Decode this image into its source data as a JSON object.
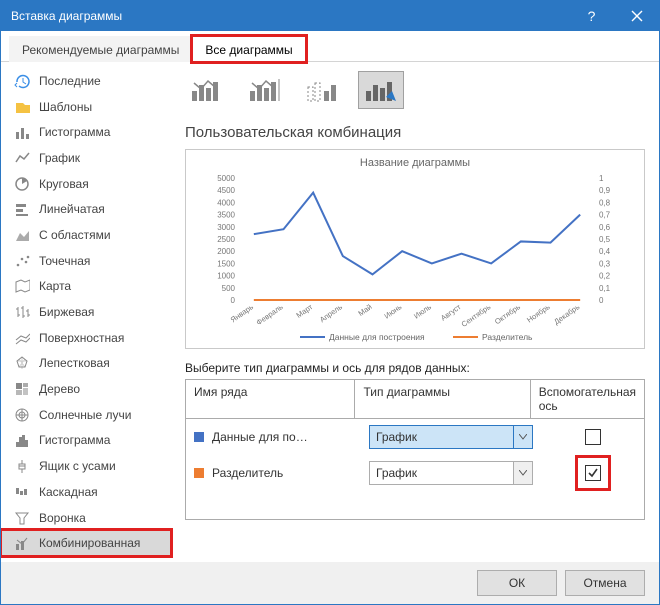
{
  "window": {
    "title": "Вставка диаграммы"
  },
  "tabs": {
    "recommended": "Рекомендуемые диаграммы",
    "all": "Все диаграммы",
    "active": "all"
  },
  "sidebar": {
    "items": [
      {
        "label": "Последние",
        "icon": "recent"
      },
      {
        "label": "Шаблоны",
        "icon": "templates"
      },
      {
        "label": "Гистограмма",
        "icon": "bar"
      },
      {
        "label": "График",
        "icon": "line"
      },
      {
        "label": "Круговая",
        "icon": "pie"
      },
      {
        "label": "Линейчатая",
        "icon": "hbar"
      },
      {
        "label": "С областями",
        "icon": "area"
      },
      {
        "label": "Точечная",
        "icon": "scatter"
      },
      {
        "label": "Карта",
        "icon": "map"
      },
      {
        "label": "Биржевая",
        "icon": "stock"
      },
      {
        "label": "Поверхностная",
        "icon": "surface"
      },
      {
        "label": "Лепестковая",
        "icon": "radar"
      },
      {
        "label": "Дерево",
        "icon": "tree"
      },
      {
        "label": "Солнечные лучи",
        "icon": "sunburst"
      },
      {
        "label": "Гистограмма",
        "icon": "histo"
      },
      {
        "label": "Ящик с усами",
        "icon": "box"
      },
      {
        "label": "Каскадная",
        "icon": "waterfall"
      },
      {
        "label": "Воронка",
        "icon": "funnel"
      },
      {
        "label": "Комбинированная",
        "icon": "combo"
      }
    ],
    "selected": 18
  },
  "subtypes": {
    "selected": 3
  },
  "main": {
    "subtitle": "Пользовательская комбинация",
    "pick_label": "Выберите тип диаграммы и ось для рядов данных:",
    "headers": {
      "name": "Имя ряда",
      "type": "Тип диаграммы",
      "axis": "Вспомогательная ось"
    },
    "rows": [
      {
        "swatch": "#4472c4",
        "name": "Данные для по…",
        "type": "График",
        "secondary": false,
        "highlight": true
      },
      {
        "swatch": "#ed7d31",
        "name": "Разделитель",
        "type": "График",
        "secondary": true,
        "highlight": false
      }
    ]
  },
  "footer": {
    "ok": "ОК",
    "cancel": "Отмена"
  },
  "chart_data": {
    "type": "line",
    "title": "Название диаграммы",
    "categories": [
      "Январь",
      "Февраль",
      "Март",
      "Апрель",
      "Май",
      "Июнь",
      "Июль",
      "Август",
      "Сентябрь",
      "Октябрь",
      "Ноябрь",
      "Декабрь"
    ],
    "series": [
      {
        "name": "Данные для построения",
        "axis": "primary",
        "color": "#4472c4",
        "values": [
          2700,
          2900,
          4400,
          1800,
          1050,
          2000,
          1500,
          1900,
          1500,
          2400,
          2350,
          3500
        ]
      },
      {
        "name": "Разделитель",
        "axis": "secondary",
        "color": "#ed7d31",
        "values": [
          0,
          0,
          0,
          0,
          0,
          0,
          0,
          0,
          0,
          0,
          0,
          0
        ]
      }
    ],
    "ylim_primary": [
      0,
      5000
    ],
    "ylim_secondary": [
      0,
      1
    ],
    "yticks_primary": [
      0,
      500,
      1000,
      1500,
      2000,
      2500,
      3000,
      3500,
      4000,
      4500,
      5000
    ],
    "yticks_secondary": [
      0,
      0.1,
      0.2,
      0.3,
      0.4,
      0.5,
      0.6,
      0.7,
      0.8,
      0.9,
      1
    ]
  }
}
